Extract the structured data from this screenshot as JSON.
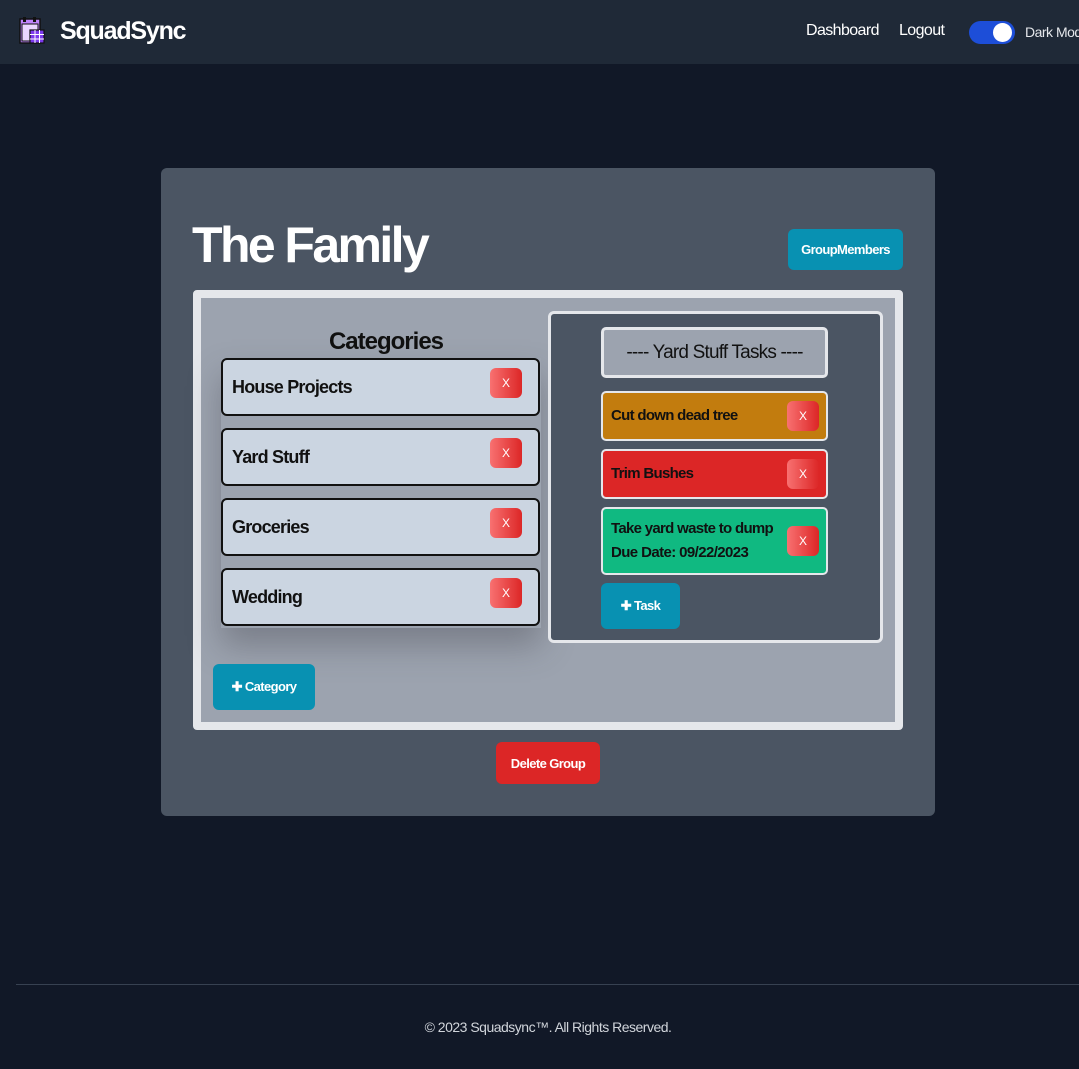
{
  "navbar": {
    "brand": "SquadSync",
    "links": {
      "dashboard": "Dashboard",
      "logout": "Logout"
    },
    "dark_mode": {
      "label": "Dark Mode",
      "enabled": true
    }
  },
  "group": {
    "title": "The Family",
    "members_button": "GroupMembers",
    "delete_button": "Delete Group"
  },
  "categories": {
    "heading": "Categories",
    "items": [
      {
        "label": "House Projects",
        "delete_label": "X"
      },
      {
        "label": "Yard Stuff",
        "delete_label": "X"
      },
      {
        "label": "Groceries",
        "delete_label": "X"
      },
      {
        "label": "Wedding",
        "delete_label": "X"
      }
    ],
    "add_button": "✚ Category"
  },
  "tasks": {
    "heading": "---- Yard Stuff Tasks ----",
    "items": [
      {
        "label": "Cut down dead tree",
        "delete_label": "X",
        "color": "#c27c0e"
      },
      {
        "label": "Trim Bushes",
        "delete_label": "X",
        "color": "#dc2626"
      },
      {
        "label": "Take yard waste to dump",
        "due": "Due Date: 09/22/2023",
        "delete_label": "X",
        "color": "#10b981"
      }
    ],
    "add_button": "✚ Task"
  },
  "footer": {
    "text": "© 2023 Squadsync™. All Rights Reserved."
  },
  "colors": {
    "background": "#111827",
    "navbar": "#1f2937",
    "panel": "#4b5563",
    "accent": "#0891b2",
    "danger": "#dc2626"
  }
}
